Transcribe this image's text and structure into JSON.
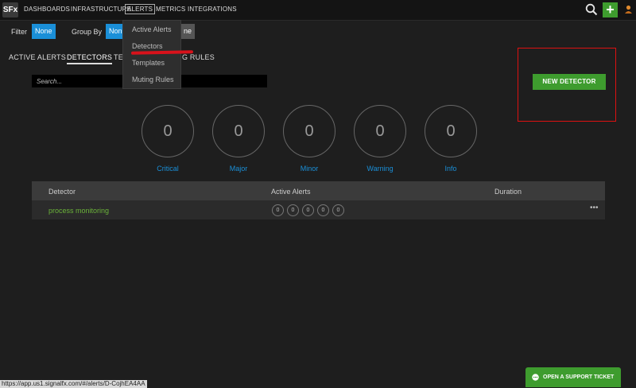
{
  "logo": "SFx",
  "nav": {
    "items": [
      "DASHBOARDS",
      "INFRASTRUCTURE",
      "ALERTS",
      "METRICS",
      "INTEGRATIONS"
    ],
    "search_icon": "search-icon",
    "plus_label": "+",
    "user_icon": "user-icon"
  },
  "filters": {
    "filter_label": "Filter",
    "filter_value": "None",
    "groupby_label": "Group By",
    "groupby_value": "Non",
    "third_value": "ne"
  },
  "tabs": [
    "ACTIVE ALERTS",
    "DETECTORS",
    "TE",
    "G RULES"
  ],
  "search": {
    "placeholder": "Search..."
  },
  "new_detector_label": "NEW DETECTOR",
  "severity": [
    {
      "label": "Critical",
      "count": "0"
    },
    {
      "label": "Major",
      "count": "0"
    },
    {
      "label": "Minor",
      "count": "0"
    },
    {
      "label": "Warning",
      "count": "0"
    },
    {
      "label": "Info",
      "count": "0"
    }
  ],
  "table": {
    "columns": [
      "Detector",
      "Active Alerts",
      "Duration"
    ],
    "rows": [
      {
        "name": "process monitoring",
        "alerts": [
          "0",
          "0",
          "0",
          "0",
          "0"
        ],
        "menu": "•••"
      }
    ]
  },
  "dropdown": {
    "items": [
      "Active Alerts",
      "Detectors",
      "Templates",
      "Muting Rules"
    ]
  },
  "status_url": "https://app.us1.signalfx.com/#/alerts/D-CojhEA4AA",
  "support_label": "OPEN A SUPPORT TICKET",
  "colors": {
    "accent_blue": "#1a8fd8",
    "accent_green": "#3e9c2e",
    "annotation_red": "#d11111"
  }
}
